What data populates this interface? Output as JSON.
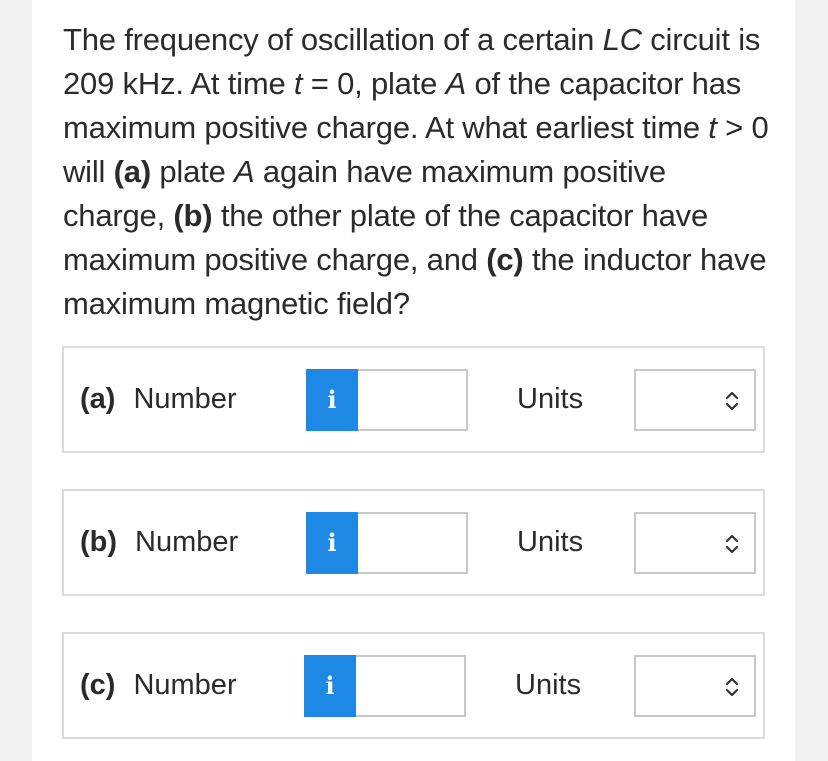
{
  "question": {
    "segments": [
      {
        "t": "The frequency of oscillation of a certain ",
        "s": "n"
      },
      {
        "t": "LC",
        "s": "i"
      },
      {
        "t": " circuit is 209 kHz. At time ",
        "s": "n"
      },
      {
        "t": "t",
        "s": "i"
      },
      {
        "t": " = 0, plate ",
        "s": "n"
      },
      {
        "t": "A",
        "s": "i"
      },
      {
        "t": " of the capacitor has maximum positive charge. At what earliest time ",
        "s": "n"
      },
      {
        "t": "t",
        "s": "i"
      },
      {
        "t": " > 0 will ",
        "s": "n"
      },
      {
        "t": "(a)",
        "s": "b"
      },
      {
        "t": " plate ",
        "s": "n"
      },
      {
        "t": "A",
        "s": "i"
      },
      {
        "t": " again have maximum positive charge, ",
        "s": "n"
      },
      {
        "t": "(b)",
        "s": "b"
      },
      {
        "t": " the other plate of the capacitor have maximum positive charge, and ",
        "s": "n"
      },
      {
        "t": "(c)",
        "s": "b"
      },
      {
        "t": " the inductor have maximum magnetic field?",
        "s": "n"
      }
    ]
  },
  "answers": [
    {
      "part": "(a)",
      "label": "Number",
      "info": "i",
      "value": "",
      "units_label": "Units",
      "units_value": ""
    },
    {
      "part": "(b)",
      "label": "Number",
      "info": "i",
      "value": "",
      "units_label": "Units",
      "units_value": ""
    },
    {
      "part": "(c)",
      "label": "Number",
      "info": "i",
      "value": "",
      "units_label": "Units",
      "units_value": ""
    }
  ],
  "colors": {
    "info_button": "#1e88e5",
    "border": "#dcdcdc",
    "text": "#2b2b2b"
  },
  "icons": {
    "info": "info-icon",
    "select": "chevron-up-down-icon"
  }
}
